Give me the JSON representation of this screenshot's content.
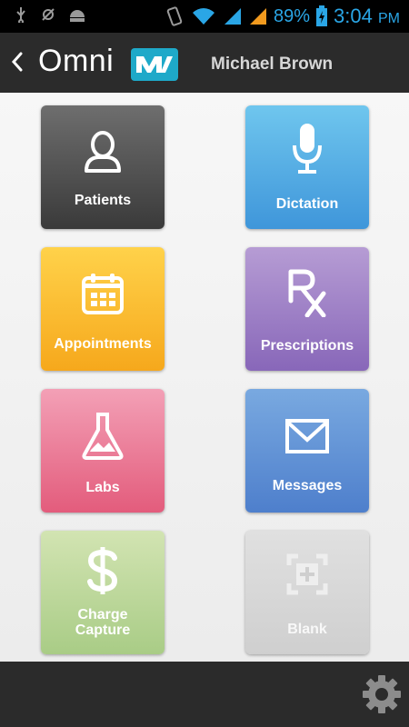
{
  "status_bar": {
    "battery": "89%",
    "time": "3:04",
    "ampm": "PM"
  },
  "header": {
    "brand": "Omni",
    "user_name": "Michael Brown"
  },
  "tiles": [
    {
      "label": "Patients",
      "color_from": "#6e6e6e",
      "color_to": "#3a3a3a",
      "icon": "person-icon"
    },
    {
      "label": "Dictation",
      "color_from": "#6fc6ee",
      "color_to": "#3f96da",
      "icon": "microphone-icon"
    },
    {
      "label": "Appointments",
      "color_from": "#ffd24a",
      "color_to": "#f6a81c",
      "icon": "calendar-icon"
    },
    {
      "label": "Prescriptions",
      "color_from": "#b69cd4",
      "color_to": "#8867b9",
      "icon": "rx-icon"
    },
    {
      "label": "Labs",
      "color_from": "#f3a0b6",
      "color_to": "#e35c7c",
      "icon": "flask-icon"
    },
    {
      "label": "Messages",
      "color_from": "#79a9e0",
      "color_to": "#4e7fcc",
      "icon": "envelope-icon"
    },
    {
      "label": "Charge Capture",
      "color_from": "#d2e4b2",
      "color_to": "#a9cc86",
      "icon": "dollar-icon"
    },
    {
      "label": "Blank",
      "color_from": "#e0e0e0",
      "color_to": "#cfcfcf",
      "icon": "add-frame-icon"
    }
  ],
  "icons": {
    "settings": "gear-icon",
    "back": "chevron-left-icon"
  }
}
